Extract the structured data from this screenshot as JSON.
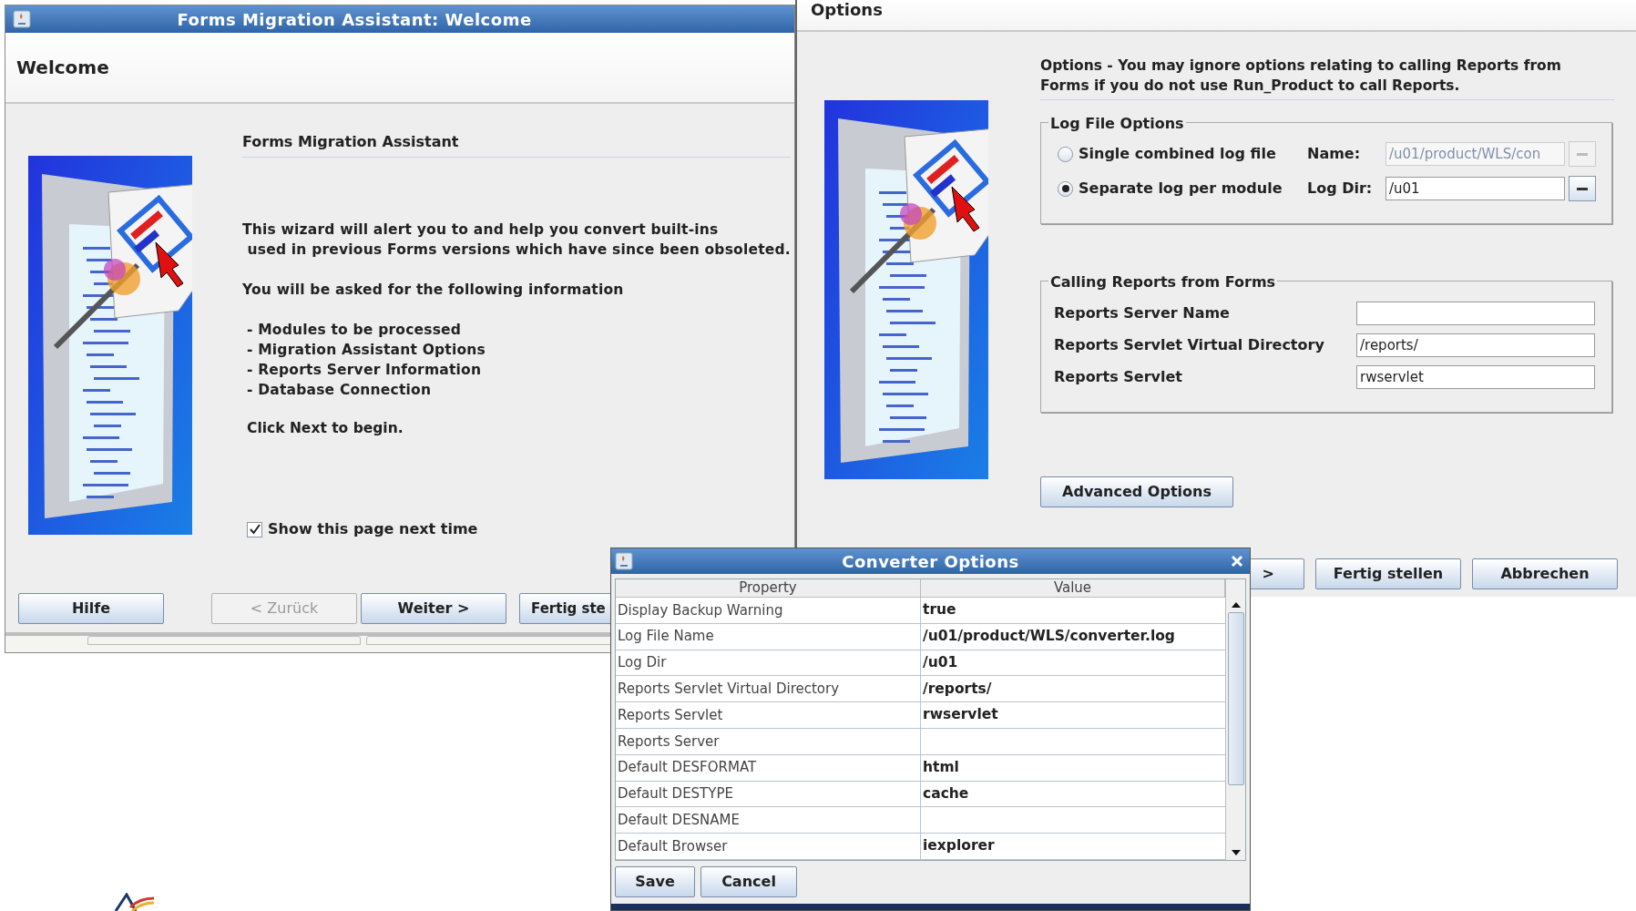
{
  "welcome_window": {
    "title": "Forms Migration Assistant: Welcome",
    "header": "Welcome",
    "section_title": "Forms Migration Assistant",
    "paragraphs": [
      "This wizard will alert you to and help you convert built-ins\n used in previous Forms versions which have since been obsoleted.",
      "You will be asked for the following information"
    ],
    "list": [
      "- Modules to be processed",
      "- Migration Assistant Options",
      "- Reports Server Information",
      "- Database Connection"
    ],
    "closing": "Click Next to begin.",
    "checkbox": {
      "label": "Show this page next time",
      "checked": true
    },
    "buttons": [
      {
        "label": "Hilfe",
        "disabled": false
      },
      {
        "label": "< Zurück",
        "disabled": true
      },
      {
        "label": "Weiter >",
        "disabled": false
      },
      {
        "label": "Fertig ste",
        "disabled": false
      }
    ]
  },
  "options_window": {
    "header": "Options",
    "description": "Options - You may ignore options relating to calling Reports from Forms if you do not use Run_Product to call Reports.",
    "log_file_options": {
      "title": "Log File Options",
      "options": [
        {
          "label": "Single combined log file",
          "selected": false
        },
        {
          "label": "Separate log per module",
          "selected": true
        }
      ],
      "fields": [
        {
          "label": "Name:",
          "value": "/u01/product/WLS/con",
          "disabled": true
        },
        {
          "label": "Log Dir:",
          "value": "/u01",
          "disabled": false
        }
      ]
    },
    "calling_reports": {
      "title": "Calling Reports from Forms",
      "fields": [
        {
          "label": "Reports Server Name"
        },
        {
          "label": "Reports Servlet Virtual Directory",
          "value": "/reports/"
        },
        {
          "label": "Reports Servlet",
          "value": "rwservlet"
        }
      ]
    },
    "advanced_button": "Advanced Options",
    "buttons": [
      ">",
      "Fertig stellen",
      "Abbrechen"
    ]
  },
  "converter_dialog": {
    "title": "Converter Options",
    "columns": [
      "Property",
      "Value"
    ],
    "rows": [
      {
        "property": "Display Backup Warning",
        "value": "true"
      },
      {
        "property": "Log File Name",
        "value": "/u01/product/WLS/converter.log"
      },
      {
        "property": "Log Dir",
        "value": "/u01"
      },
      {
        "property": "Reports Servlet Virtual Directory",
        "value": "/reports/"
      },
      {
        "property": "Reports Servlet",
        "value": "rwservlet"
      },
      {
        "property": "Reports Server"
      },
      {
        "property": "Default DESFORMAT",
        "value": "html"
      },
      {
        "property": "Default DESTYPE",
        "value": "cache"
      },
      {
        "property": "Default DESNAME"
      },
      {
        "property": "Default Browser",
        "value": "iexplorer"
      }
    ],
    "buttons": [
      "Save",
      "Cancel"
    ]
  }
}
